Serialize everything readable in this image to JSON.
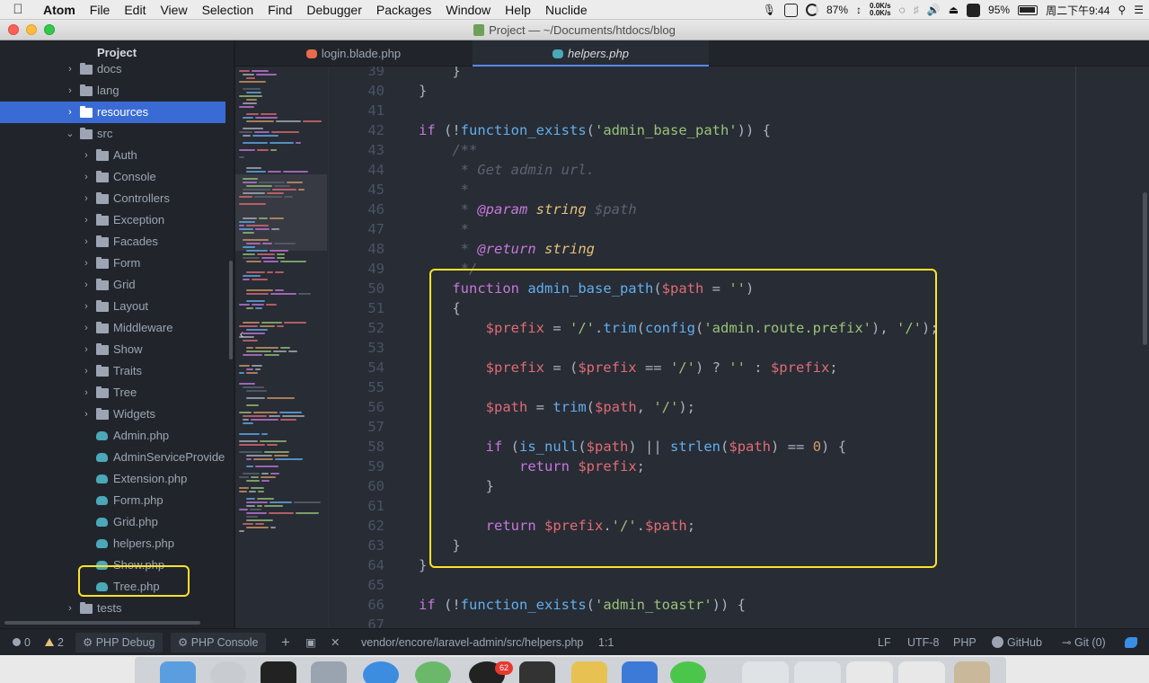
{
  "menubar": {
    "app_name": "Atom",
    "items": [
      "File",
      "Edit",
      "View",
      "Selection",
      "Find",
      "Debugger",
      "Packages",
      "Window",
      "Help",
      "Nuclide"
    ],
    "cpu": "87%",
    "net_up": "0.0K/s",
    "net_down": "0.0K/s",
    "battery": "95%",
    "clock": "周二下午9:44"
  },
  "window": {
    "title": "Project — ~/Documents/htdocs/blog"
  },
  "tree": {
    "header": "Project",
    "items": [
      {
        "label": "docs",
        "type": "folder",
        "state": "collapsed"
      },
      {
        "label": "lang",
        "type": "folder",
        "state": "collapsed"
      },
      {
        "label": "resources",
        "type": "folder",
        "state": "collapsed",
        "selected": true
      },
      {
        "label": "src",
        "type": "folder",
        "state": "expanded"
      },
      {
        "label": "Auth",
        "type": "folder",
        "state": "collapsed"
      },
      {
        "label": "Console",
        "type": "folder",
        "state": "collapsed"
      },
      {
        "label": "Controllers",
        "type": "folder",
        "state": "collapsed"
      },
      {
        "label": "Exception",
        "type": "folder",
        "state": "collapsed"
      },
      {
        "label": "Facades",
        "type": "folder",
        "state": "collapsed"
      },
      {
        "label": "Form",
        "type": "folder",
        "state": "collapsed"
      },
      {
        "label": "Grid",
        "type": "folder",
        "state": "collapsed"
      },
      {
        "label": "Layout",
        "type": "folder",
        "state": "collapsed"
      },
      {
        "label": "Middleware",
        "type": "folder",
        "state": "collapsed"
      },
      {
        "label": "Show",
        "type": "folder",
        "state": "collapsed"
      },
      {
        "label": "Traits",
        "type": "folder",
        "state": "collapsed"
      },
      {
        "label": "Tree",
        "type": "folder",
        "state": "collapsed"
      },
      {
        "label": "Widgets",
        "type": "folder",
        "state": "collapsed"
      },
      {
        "label": "Admin.php",
        "type": "php"
      },
      {
        "label": "AdminServiceProvider.php",
        "type": "php"
      },
      {
        "label": "Extension.php",
        "type": "php"
      },
      {
        "label": "Form.php",
        "type": "php"
      },
      {
        "label": "Grid.php",
        "type": "php"
      },
      {
        "label": "helpers.php",
        "type": "php",
        "highlighted": true
      },
      {
        "label": "Show.php",
        "type": "php"
      },
      {
        "label": "Tree.php",
        "type": "php"
      },
      {
        "label": "tests",
        "type": "folder",
        "state": "collapsed"
      }
    ]
  },
  "tabs": [
    {
      "label": "login.blade.php",
      "active": false,
      "icon": "laravel-icon"
    },
    {
      "label": "helpers.php",
      "active": true,
      "icon": "php-elephant-icon"
    }
  ],
  "editor": {
    "line_numbers": [
      "39",
      "40",
      "41",
      "42",
      "43",
      "44",
      "45",
      "46",
      "47",
      "48",
      "49",
      "50",
      "51",
      "52",
      "53",
      "54",
      "55",
      "56",
      "57",
      "58",
      "59",
      "60",
      "61",
      "62",
      "63",
      "64",
      "65",
      "66",
      "67"
    ],
    "lines": [
      [
        [
          "punc",
          "    }"
        ]
      ],
      [
        [
          "punc",
          "}"
        ]
      ],
      [],
      [
        [
          "kw",
          "if"
        ],
        [
          "punc",
          " (!"
        ],
        [
          "fn",
          "function_exists"
        ],
        [
          "punc",
          "("
        ],
        [
          "str",
          "'admin_base_path'"
        ],
        [
          "punc",
          ")) {"
        ]
      ],
      [
        [
          "cm",
          "    /**"
        ]
      ],
      [
        [
          "cm",
          "     * Get admin url."
        ]
      ],
      [
        [
          "cm",
          "     *"
        ]
      ],
      [
        [
          "cm",
          "     * "
        ],
        [
          "cm-tag",
          "@param"
        ],
        [
          "cm",
          " "
        ],
        [
          "cm-type",
          "string"
        ],
        [
          "cm",
          " $path"
        ]
      ],
      [
        [
          "cm",
          "     *"
        ]
      ],
      [
        [
          "cm",
          "     * "
        ],
        [
          "cm-tag",
          "@return"
        ],
        [
          "cm",
          " "
        ],
        [
          "cm-type",
          "string"
        ]
      ],
      [
        [
          "cm",
          "     */"
        ]
      ],
      [
        [
          "kw",
          "    function"
        ],
        [
          "punc",
          " "
        ],
        [
          "fn",
          "admin_base_path"
        ],
        [
          "punc",
          "("
        ],
        [
          "var",
          "$path"
        ],
        [
          "punc",
          " = "
        ],
        [
          "str",
          "''"
        ],
        [
          "punc",
          ")"
        ]
      ],
      [
        [
          "punc",
          "    {"
        ]
      ],
      [
        [
          "var",
          "        $prefix"
        ],
        [
          "punc",
          " = "
        ],
        [
          "str",
          "'/'"
        ],
        [
          "punc",
          "."
        ],
        [
          "fn",
          "trim"
        ],
        [
          "punc",
          "("
        ],
        [
          "fn",
          "config"
        ],
        [
          "punc",
          "("
        ],
        [
          "str",
          "'admin.route.prefix'"
        ],
        [
          "punc",
          "), "
        ],
        [
          "str",
          "'/'"
        ],
        [
          "punc",
          ");"
        ]
      ],
      [],
      [
        [
          "var",
          "        $prefix"
        ],
        [
          "punc",
          " = ("
        ],
        [
          "var",
          "$prefix"
        ],
        [
          "punc",
          " == "
        ],
        [
          "str",
          "'/'"
        ],
        [
          "punc",
          ") ? "
        ],
        [
          "str",
          "''"
        ],
        [
          "punc",
          " : "
        ],
        [
          "var",
          "$prefix"
        ],
        [
          "punc",
          ";"
        ]
      ],
      [],
      [
        [
          "var",
          "        $path"
        ],
        [
          "punc",
          " = "
        ],
        [
          "fn",
          "trim"
        ],
        [
          "punc",
          "("
        ],
        [
          "var",
          "$path"
        ],
        [
          "punc",
          ", "
        ],
        [
          "str",
          "'/'"
        ],
        [
          "punc",
          ");"
        ]
      ],
      [],
      [
        [
          "kw",
          "        if"
        ],
        [
          "punc",
          " ("
        ],
        [
          "fn",
          "is_null"
        ],
        [
          "punc",
          "("
        ],
        [
          "var",
          "$path"
        ],
        [
          "punc",
          ") || "
        ],
        [
          "fn",
          "strlen"
        ],
        [
          "punc",
          "("
        ],
        [
          "var",
          "$path"
        ],
        [
          "punc",
          ") == "
        ],
        [
          "num",
          "0"
        ],
        [
          "punc",
          ") {"
        ]
      ],
      [
        [
          "kw",
          "            return"
        ],
        [
          "punc",
          " "
        ],
        [
          "var",
          "$prefix"
        ],
        [
          "punc",
          ";"
        ]
      ],
      [
        [
          "punc",
          "        }"
        ]
      ],
      [],
      [
        [
          "kw",
          "        return"
        ],
        [
          "punc",
          " "
        ],
        [
          "var",
          "$prefix"
        ],
        [
          "punc",
          "."
        ],
        [
          "str",
          "'/'"
        ],
        [
          "punc",
          "."
        ],
        [
          "var",
          "$path"
        ],
        [
          "punc",
          ";"
        ]
      ],
      [
        [
          "punc",
          "    }"
        ]
      ],
      [
        [
          "punc",
          "}"
        ]
      ],
      [],
      [
        [
          "kw",
          "if"
        ],
        [
          "punc",
          " (!"
        ],
        [
          "fn",
          "function_exists"
        ],
        [
          "punc",
          "("
        ],
        [
          "str",
          "'admin_toastr'"
        ],
        [
          "punc",
          ")) {"
        ]
      ],
      []
    ]
  },
  "statusbar": {
    "errors": "0",
    "warnings": "2",
    "php_debug": "PHP Debug",
    "php_console": "PHP Console",
    "add": "+",
    "close": "✕",
    "file_path": "vendor/encore/laravel-admin/src/helpers.php",
    "cursor": "1:1",
    "line_ending": "LF",
    "encoding": "UTF-8",
    "grammar": "PHP",
    "github": "GitHub",
    "git": "Git (0)"
  },
  "dock": {
    "qq_badge": "62"
  }
}
